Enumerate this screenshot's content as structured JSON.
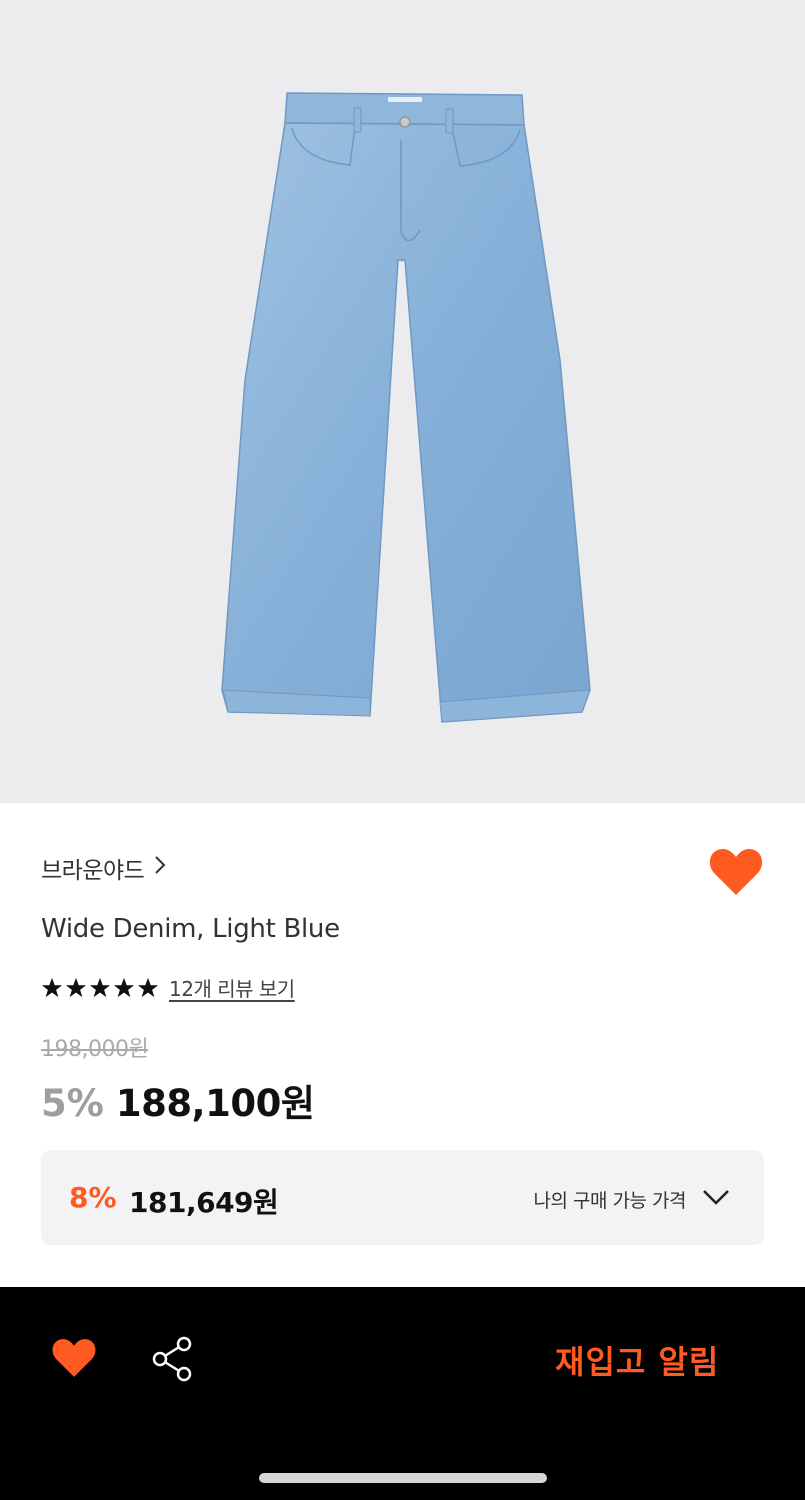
{
  "brand": {
    "name": "브라운야드",
    "chevron_icon": "chevron-right-icon"
  },
  "product": {
    "name": "Wide Denim, Light Blue",
    "image_icon": "product-jeans-image",
    "rating_stars": 5,
    "review_link": "12개 리뷰 보기",
    "original_price": "198,000원",
    "discount_percent": "5%",
    "sale_price": "188,100원"
  },
  "my_price": {
    "discount_percent": "8%",
    "price": "181,649원",
    "label": "나의 구매 가능 가격"
  },
  "bottom_bar": {
    "like_icon": "heart-icon",
    "share_icon": "share-icon",
    "restock_button": "재입고 알림"
  },
  "colors": {
    "accent": "#ff5a1f",
    "hero_bg": "#ececee",
    "bar_bg": "#000000",
    "denim": "#8ab3d8"
  }
}
